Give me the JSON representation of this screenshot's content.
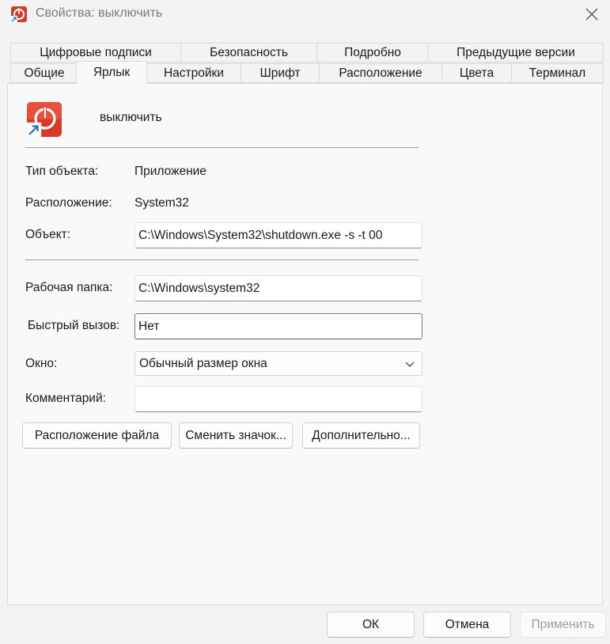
{
  "window": {
    "title": "Свойства: выключить"
  },
  "tabs_row1": [
    {
      "label": "Цифровые подписи"
    },
    {
      "label": "Безопасность"
    },
    {
      "label": "Подробно"
    },
    {
      "label": "Предыдущие версии"
    }
  ],
  "tabs_row2": [
    {
      "label": "Общие"
    },
    {
      "label": "Ярлык"
    },
    {
      "label": "Настройки"
    },
    {
      "label": "Шрифт"
    },
    {
      "label": "Расположение"
    },
    {
      "label": "Цвета"
    },
    {
      "label": "Терминал"
    }
  ],
  "active_tab": "Ярлык",
  "shortcut": {
    "name": "выключить",
    "icon": "power-shutdown-icon",
    "icon_color": "#d83a2a"
  },
  "props": {
    "type_label": "Тип объекта:",
    "type_value": "Приложение",
    "location_label": "Расположение:",
    "location_value": "System32",
    "target_label": "Объект:",
    "target_value": "C:\\Windows\\System32\\shutdown.exe -s -t 00",
    "workdir_label": "Рабочая папка:",
    "workdir_value": "C:\\Windows\\system32",
    "hotkey_label": "Быстрый вызов:",
    "hotkey_value": "Нет",
    "window_label": "Окно:",
    "window_value": "Обычный размер окна",
    "comment_label": "Комментарий:",
    "comment_value": ""
  },
  "actions": {
    "open_location": "Расположение файла",
    "change_icon": "Сменить значок...",
    "advanced": "Дополнительно..."
  },
  "footer": {
    "ok": "ОК",
    "cancel": "Отмена",
    "apply": "Применить"
  }
}
